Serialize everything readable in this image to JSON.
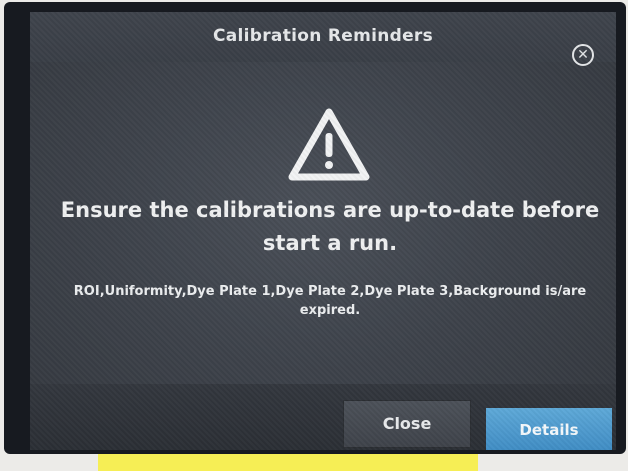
{
  "dialog": {
    "title": "Calibration Reminders",
    "close_icon_glyph": "✕",
    "warning_icon": "warning-triangle-icon",
    "message": "Ensure the calibrations are up-to-date before start a run.",
    "detail": "ROI,Uniformity,Dye Plate 1,Dye Plate 2,Dye Plate 3,Background is/are expired.",
    "buttons": {
      "close_label": "Close",
      "details_label": "Details"
    }
  },
  "colors": {
    "dialog_background": "#3e434b",
    "details_button": "#4a98cc",
    "close_button": "#464a51",
    "text": "#f0f1f2",
    "sticky_note": "#f6ee55"
  }
}
